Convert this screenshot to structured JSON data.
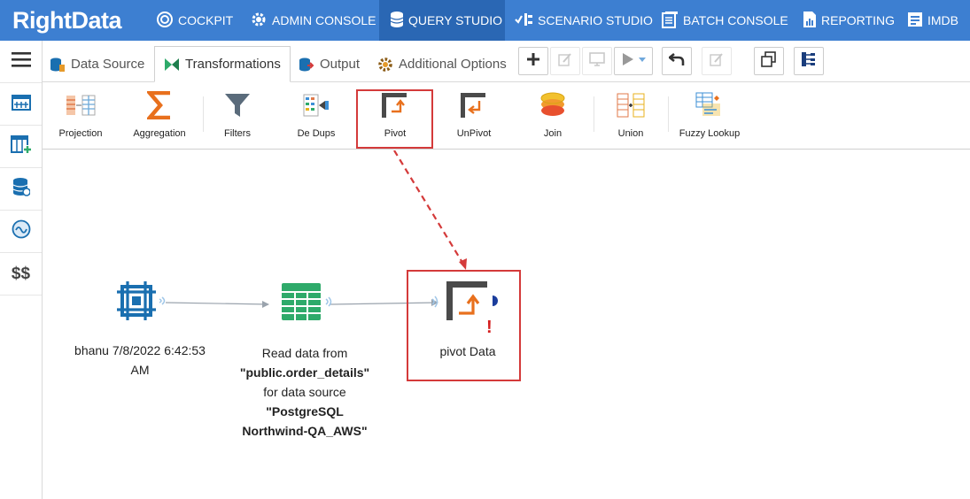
{
  "brand": {
    "logo_text": "RightData"
  },
  "nav": {
    "cockpit": "COCKPIT",
    "admin_console": "ADMIN CONSOLE",
    "query_studio": "QUERY STUDIO",
    "scenario_studio": "SCENARIO STUDIO",
    "batch_console": "BATCH CONSOLE",
    "reporting": "REPORTING",
    "imdb": "IMDB"
  },
  "rail": {
    "dollar_label": "$$"
  },
  "tabs": {
    "data_source": "Data Source",
    "transformations": "Transformations",
    "output": "Output",
    "additional_options": "Additional Options"
  },
  "ribbon": {
    "projection": "Projection",
    "aggregation": "Aggregation",
    "filters": "Filters",
    "dedups": "De Dups",
    "pivot": "Pivot",
    "unpivot": "UnPivot",
    "join": "Join",
    "union": "Union",
    "fuzzy_lookup": "Fuzzy Lookup"
  },
  "canvas": {
    "node1": {
      "line1": "bhanu 7/8/2022 6:42:53",
      "line2": "AM"
    },
    "node2": {
      "line1": "Read data from",
      "line2": "\"public.order_details\"",
      "line3": "for data source",
      "line4": "\"PostgreSQL",
      "line5": "Northwind-QA_AWS\""
    },
    "node3": {
      "label": "pivot Data",
      "warning": "!"
    }
  },
  "colors": {
    "nav_bg": "#3d7fd1",
    "nav_active": "#2a67b4",
    "highlight": "#d43a3a",
    "node_blue": "#1a6fb0",
    "node_green": "#2eaa6a"
  }
}
